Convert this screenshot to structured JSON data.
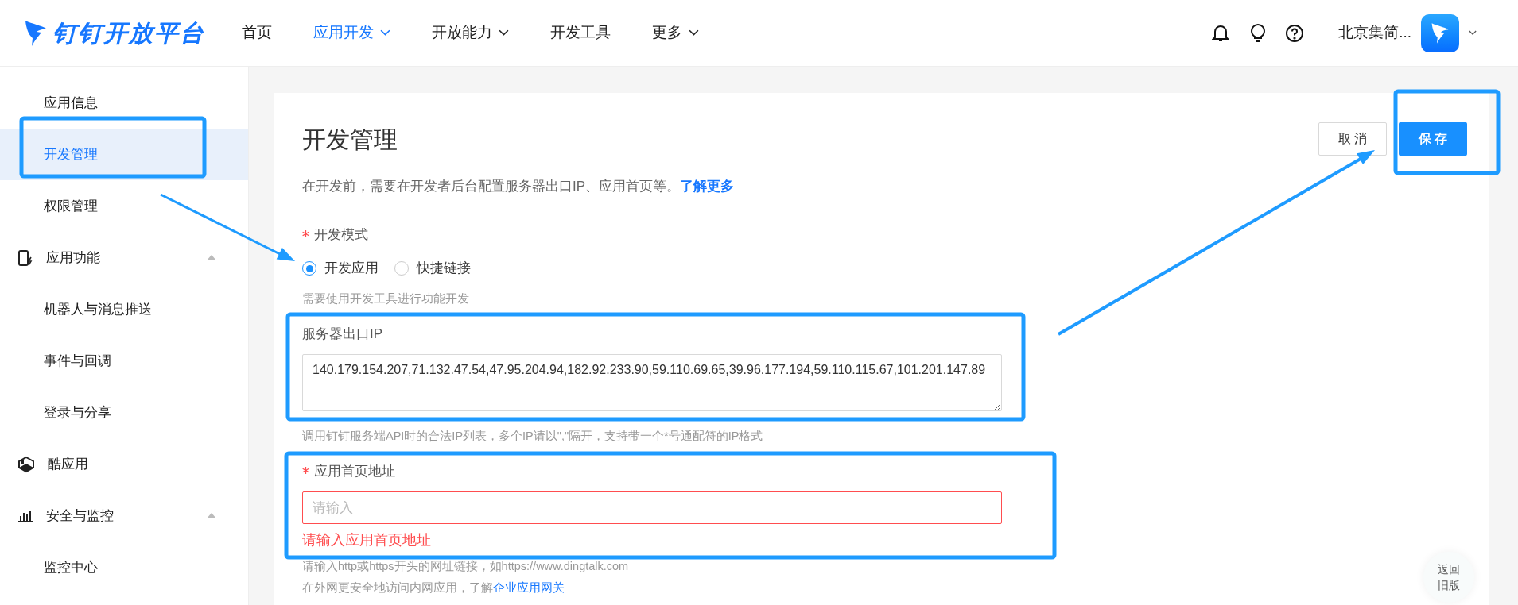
{
  "header": {
    "logo": "钉钉开放平台",
    "nav": [
      {
        "label": "首页",
        "selected": false,
        "dropdown": false
      },
      {
        "label": "应用开发",
        "selected": true,
        "dropdown": true
      },
      {
        "label": "开放能力",
        "selected": false,
        "dropdown": true
      },
      {
        "label": "开发工具",
        "selected": false,
        "dropdown": false
      },
      {
        "label": "更多",
        "selected": false,
        "dropdown": true
      }
    ],
    "org_name": "北京集简..."
  },
  "sidebar": {
    "items": [
      {
        "kind": "link",
        "label": "应用信息",
        "selected": false
      },
      {
        "kind": "link",
        "label": "开发管理",
        "selected": true
      },
      {
        "kind": "link",
        "label": "权限管理",
        "selected": false
      },
      {
        "kind": "group",
        "label": "应用功能",
        "expanded": true,
        "children": [
          {
            "label": "机器人与消息推送",
            "selected": false
          },
          {
            "label": "事件与回调",
            "selected": false
          },
          {
            "label": "登录与分享",
            "selected": false
          }
        ]
      },
      {
        "kind": "group",
        "label": "酷应用"
      },
      {
        "kind": "group",
        "label": "安全与监控",
        "expanded": true,
        "children": [
          {
            "label": "监控中心",
            "selected": false
          }
        ]
      }
    ]
  },
  "page": {
    "title": "开发管理",
    "description": "在开发前，需要在开发者后台配置服务器出口IP、应用首页等。",
    "description_link": "了解更多",
    "buttons": [
      {
        "label": "取 消",
        "kind": "default"
      },
      {
        "label": "保 存",
        "kind": "primary"
      }
    ],
    "dev_mode": {
      "label": "开发模式",
      "required": true,
      "options": [
        {
          "label": "开发应用",
          "selected": true
        },
        {
          "label": "快捷链接",
          "selected": false
        }
      ],
      "hint": "需要使用开发工具进行功能开发"
    },
    "server_ip": {
      "label": "服务器出口IP",
      "required": false,
      "value": "140.179.154.207,71.132.47.54,47.95.204.94,182.92.233.90,59.110.69.65,39.96.177.194,59.110.115.67,101.201.147.89",
      "hint": "调用钉钉服务端API时的合法IP列表，多个IP请以\",\"隔开，支持带一个*号通配符的IP格式"
    },
    "homepage": {
      "label": "应用首页地址",
      "required": true,
      "placeholder": "请输入",
      "error": "请输入应用首页地址",
      "hint": "请输入http或https开头的网址链接，如https://www.dingtalk.com",
      "hint2": "在外网更安全地访问内网应用，了解",
      "hint2_link": "企业应用网关"
    }
  },
  "back_button": "返回旧版"
}
